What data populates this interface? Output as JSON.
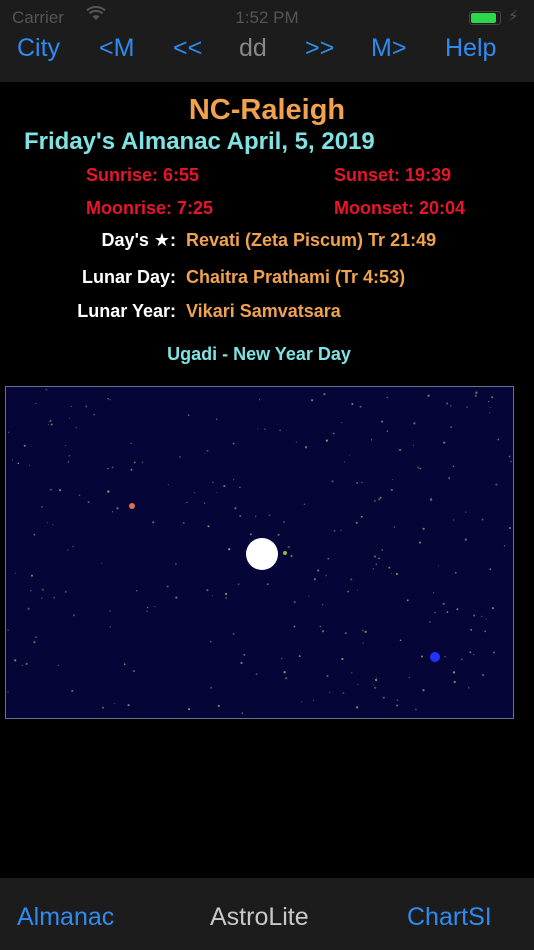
{
  "status_bar": {
    "carrier": "Carrier",
    "time": "1:52 PM",
    "battery_level": 0.9,
    "wifi_icon": "wifi-icon",
    "charging_icon": "bolt-icon"
  },
  "nav": {
    "city": "City",
    "prev_month": "<M",
    "prev_day": "<<",
    "day": "dd",
    "next_day": ">>",
    "next_month": "M>",
    "help": "Help"
  },
  "almanac": {
    "city_title": "NC-Raleigh",
    "date_title": "Friday's Almanac April, 5, 2019",
    "sunrise": "Sunrise: 6:55",
    "sunset": "Sunset: 19:39",
    "moonrise": "Moonrise: 7:25",
    "moonset": "Moonset: 20:04",
    "star_label": "Day's ★:",
    "star_value": "Revati (Zeta Piscum) Tr 21:49",
    "lunar_day_label": "Lunar Day:",
    "lunar_day_value": "Chaitra Prathami (Tr 4:53)",
    "lunar_year_label": "Lunar Year:",
    "lunar_year_value": "Vikari Samvatsara",
    "festival": "Ugadi - New Year Day"
  },
  "sky": {
    "background": "#050538",
    "moon_color": "#ffffff",
    "planet_colors": [
      "#e07050",
      "#9ab040",
      "#2233ff"
    ],
    "star_color": "#9c9c6c"
  },
  "tabs": {
    "almanac": "Almanac",
    "app_title": "AstroLite",
    "chart": "ChartSI"
  },
  "colors": {
    "accent_blue": "#2f8bf0",
    "orange": "#f0a24e",
    "cyan": "#7fe3e3",
    "red": "#e8152a"
  }
}
